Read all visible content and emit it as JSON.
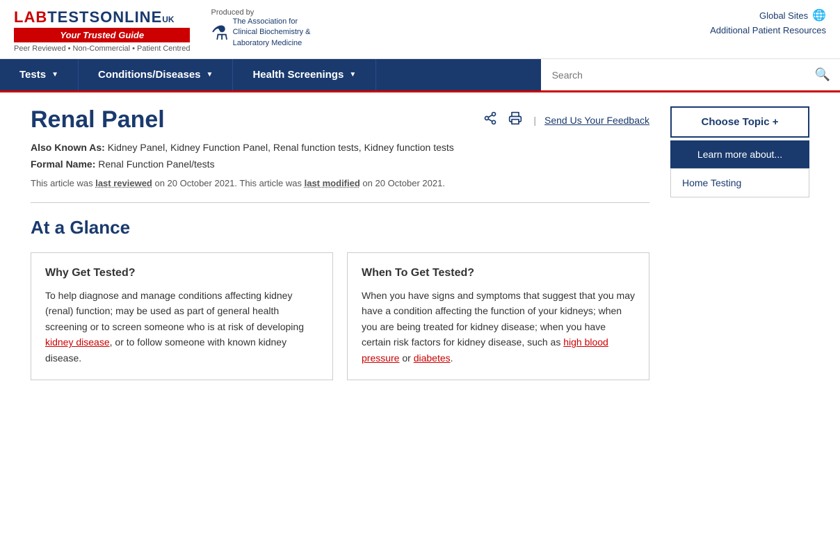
{
  "header": {
    "logo_lab": "LAB",
    "logo_tests": " TESTS",
    "logo_online": " ONLINE",
    "logo_uk": "UK",
    "logo_tagline": "Your Trusted Guide",
    "logo_sub": "Peer Reviewed • Non-Commercial • Patient Centred",
    "produced_by": "Produced by",
    "association_line1": "The Association for",
    "association_line2": "Clinical Biochemistry &",
    "association_line3": "Laboratory Medicine",
    "global_sites": "Global Sites",
    "additional_resources": "Additional Patient Resources"
  },
  "nav": {
    "items": [
      {
        "label": "Tests",
        "id": "nav-tests"
      },
      {
        "label": "Conditions/Diseases",
        "id": "nav-conditions"
      },
      {
        "label": "Health Screenings",
        "id": "nav-screenings"
      }
    ],
    "search_placeholder": "Search"
  },
  "article": {
    "title": "Renal Panel",
    "also_known_label": "Also Known As:",
    "also_known_value": "Kidney Panel, Kidney Function Panel, Renal function tests, Kidney function tests",
    "formal_name_label": "Formal Name:",
    "formal_name_value": "Renal Function Panel/tests",
    "review_text_pre": "This article was",
    "review_label": "last reviewed",
    "review_date": "on 20 October 2021.",
    "modified_text_pre": "This article was",
    "modified_label": "last modified",
    "modified_date": "on 20 October 2021."
  },
  "sidebar": {
    "choose_topic": "Choose Topic +",
    "learn_more": "Learn more about...",
    "home_testing": "Home Testing"
  },
  "at_a_glance": {
    "title": "At a Glance",
    "card1": {
      "title": "Why Get Tested?",
      "text": "To help diagnose and manage conditions affecting kidney (renal) function; may be used as part of general health screening or to screen someone who is at risk of developing ",
      "link_text": "kidney disease",
      "text2": ", or to follow someone with known kidney disease."
    },
    "card2": {
      "title": "When To Get Tested?",
      "text": "When you have signs and symptoms that suggest that you may have a condition affecting the function of your kidneys; when you are being treated for kidney disease; when you have certain risk factors for kidney disease, such as ",
      "link1_text": "high blood pressure",
      "text2": " or ",
      "link2_text": "diabetes",
      "text3": "."
    }
  }
}
